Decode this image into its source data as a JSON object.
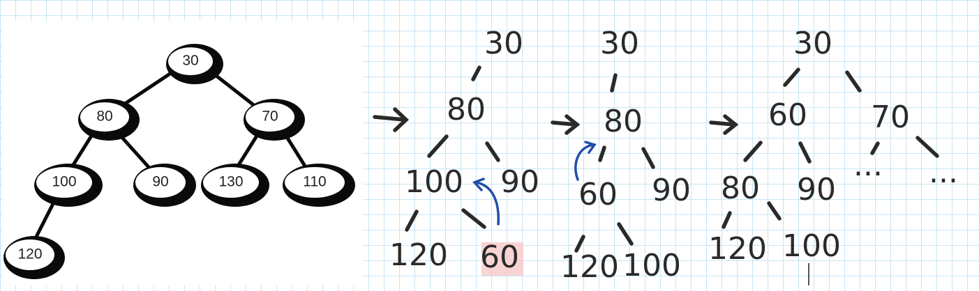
{
  "printed_tree": {
    "nodes": [
      {
        "id": "n30",
        "label": "30"
      },
      {
        "id": "n80",
        "label": "80"
      },
      {
        "id": "n70",
        "label": "70"
      },
      {
        "id": "n100",
        "label": "100"
      },
      {
        "id": "n90",
        "label": "90"
      },
      {
        "id": "n130",
        "label": "130"
      },
      {
        "id": "n110",
        "label": "110"
      },
      {
        "id": "n120",
        "label": "120"
      }
    ],
    "edges": [
      [
        "n30",
        "n80"
      ],
      [
        "n30",
        "n70"
      ],
      [
        "n80",
        "n100"
      ],
      [
        "n80",
        "n90"
      ],
      [
        "n70",
        "n130"
      ],
      [
        "n70",
        "n110"
      ],
      [
        "n100",
        "n120"
      ]
    ]
  },
  "sketch_1": {
    "labels": {
      "root": "30",
      "mid": "80",
      "left": "100",
      "right": "90",
      "ll": "120",
      "lr": "60"
    },
    "highlight_color": "#f6c9c9"
  },
  "sketch_2": {
    "labels": {
      "root": "30",
      "mid": "80",
      "left": "60",
      "right": "90",
      "ll": "120",
      "lr": "100"
    }
  },
  "sketch_3": {
    "labels": {
      "root": "30",
      "left": "60",
      "right": "70",
      "ll": "80",
      "lr": "90",
      "rl": "...",
      "rr": "...",
      "lll": "120",
      "llr": "100"
    }
  },
  "colors": {
    "grid_line": "#b9ddf0",
    "swap_arrow": "#1f4fa8",
    "ink": "#2a2a2a"
  },
  "icons": [
    "step-arrow-icon",
    "swap-arrow-icon"
  ]
}
